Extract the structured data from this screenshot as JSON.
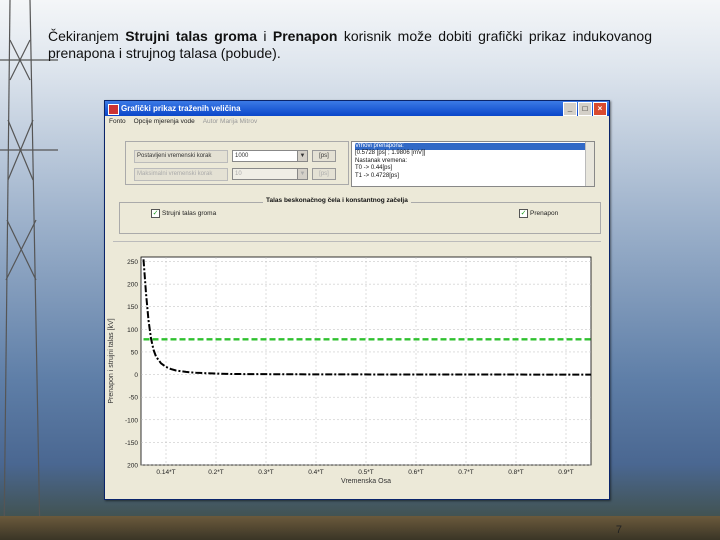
{
  "caption": {
    "prefix": "Čekiranjem ",
    "bold1": "Strujni talas groma",
    "mid": " i ",
    "bold2": "Prenapon",
    "suffix": " korisnik može dobiti grafički prikaz indukovanog prenapona i strujnog talasa (pobude)."
  },
  "page_number": "7",
  "window": {
    "title": "Grafički prikaz traženih veličina",
    "controls": [
      "_",
      "□",
      "×"
    ],
    "menu": [
      {
        "label": "Fonto",
        "enabled": true
      },
      {
        "label": "Opcije mjerenja vode",
        "enabled": true
      },
      {
        "label": "Autor Marija Mitrov",
        "enabled": false
      }
    ],
    "params": [
      {
        "label": "Postavljeni vremenski korak",
        "value": "1000",
        "unit": "[ps]",
        "enabled": true
      },
      {
        "label": "Maksimalni vremenski korak",
        "value": "10",
        "unit": "[ps]",
        "enabled": false
      }
    ],
    "results": [
      {
        "text": "Vrhovi prenapona:",
        "selected": true
      },
      {
        "text": "[0.5728 [ps] ; 1.9806 [mV]]",
        "selected": false
      },
      {
        "text": "",
        "selected": false
      },
      {
        "text": "Nastanak vremena:",
        "selected": false
      },
      {
        "text": "T0 -> 0.44[ps]",
        "selected": false
      },
      {
        "text": "T1 -> 0.4728[ps]",
        "selected": false
      }
    ],
    "group_title": "Talas beskonačnog čela i konstantnog začelja",
    "checkbox_left": {
      "label": "Strujni talas groma",
      "checked": true
    },
    "checkbox_right": {
      "label": "Prenapon",
      "checked": true
    }
  },
  "chart_data": {
    "type": "line",
    "ylabel": "Prenapon i strujni talas [kV]",
    "xlabel": "Vremenska Osa",
    "ylim": [
      -200,
      260
    ],
    "yticks": [
      -200,
      -150,
      -100,
      -50,
      0,
      50,
      100,
      150,
      200,
      250
    ],
    "ytick_labels": [
      "200",
      "-150",
      "-100",
      "-50",
      "0",
      "50",
      "100",
      "150",
      "200",
      "250"
    ],
    "xlim": [
      0.09,
      0.99
    ],
    "xticks": [
      0.14,
      0.24,
      0.34,
      0.44,
      0.54,
      0.64,
      0.74,
      0.84,
      0.94
    ],
    "xtick_labels": [
      "0.14*T",
      "0.2*T",
      "0.3*T",
      "0.4*T",
      "0.5*T",
      "0.6*T",
      "0.7*T",
      "0.8*T",
      "0.9*T"
    ],
    "grid": true,
    "series": [
      {
        "color": "#000000",
        "style": "dashdot",
        "x": [
          0.095,
          0.1,
          0.105,
          0.11,
          0.115,
          0.12,
          0.13,
          0.14,
          0.15,
          0.16,
          0.18,
          0.2,
          0.23,
          0.26,
          0.3,
          0.4,
          0.5,
          0.6,
          0.7,
          0.8,
          0.9,
          0.99
        ],
        "y": [
          255,
          180,
          120,
          80,
          55,
          40,
          25,
          17,
          12,
          9,
          6,
          4,
          2.5,
          1.5,
          1,
          0.5,
          0.3,
          0.2,
          0.1,
          0.1,
          0,
          0
        ]
      },
      {
        "color": "#2fc12f",
        "style": "dashed",
        "x": [
          0.095,
          0.99
        ],
        "y": [
          78,
          78
        ]
      }
    ]
  }
}
